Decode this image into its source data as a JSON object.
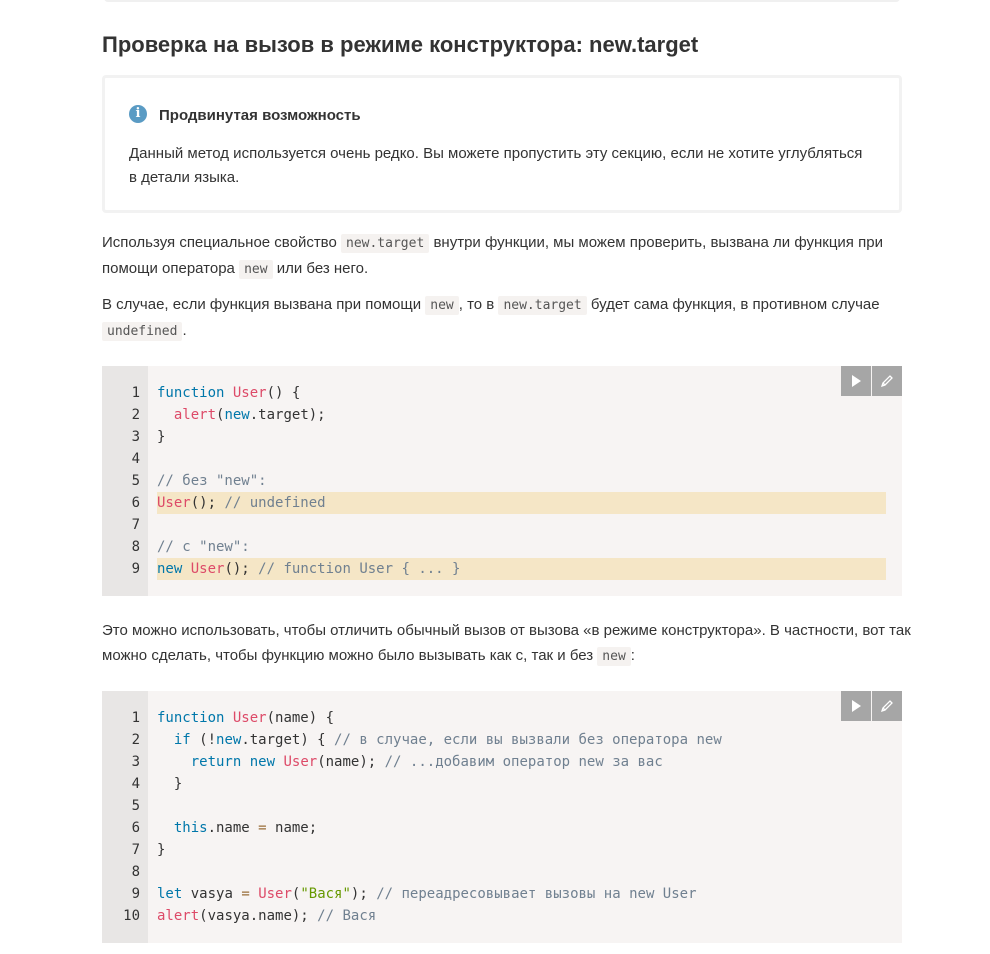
{
  "heading": "Проверка на вызов в режиме конструктора: new.target",
  "note": {
    "icon": "info-icon",
    "title": "Продвинутая возможность",
    "text": "Данный метод используется очень редко. Вы можете пропустить эту секцию, если не хотите углубляться в детали языка."
  },
  "para1": {
    "t1": "Используя специальное свойство ",
    "c1": "new.target",
    "t2": " внутри функции, мы можем проверить, вызвана ли функция при помощи оператора ",
    "c2": "new",
    "t3": " или без него."
  },
  "para2": {
    "t1": "В случае, если функция вызвана при помощи ",
    "c1": "new",
    "t2": ", то в ",
    "c2": "new.target",
    "t3": " будет сама функция, в противном случае ",
    "c3": "undefined",
    "t4": "."
  },
  "para3": {
    "t1": "Это можно использовать, чтобы отличить обычный вызов от вызова «в режиме конструктора». В частности, вот так можно сделать, чтобы функцию можно было вызывать как с, так и без ",
    "c1": "new",
    "t2": ":"
  },
  "code1": {
    "lines": [
      {
        "n": "1",
        "parts": [
          [
            "kw",
            "function"
          ],
          [
            "",
            "  "
          ],
          [
            "fn",
            "User"
          ],
          [
            "",
            "() {"
          ]
        ]
      },
      {
        "n": "2",
        "parts": [
          [
            "",
            "  "
          ],
          [
            "fn",
            "alert"
          ],
          [
            "",
            "("
          ],
          [
            "kw",
            "new"
          ],
          [
            "",
            ".target);"
          ]
        ]
      },
      {
        "n": "3",
        "parts": [
          [
            "",
            "}"
          ]
        ]
      },
      {
        "n": "4",
        "parts": []
      },
      {
        "n": "5",
        "parts": [
          [
            "cm",
            "// без \"new\":"
          ]
        ]
      },
      {
        "n": "6",
        "hl": true,
        "parts": [
          [
            "fn",
            "User"
          ],
          [
            "",
            "(); "
          ],
          [
            "cm",
            "// undefined"
          ]
        ]
      },
      {
        "n": "7",
        "parts": []
      },
      {
        "n": "8",
        "parts": [
          [
            "cm",
            "// с \"new\":"
          ]
        ]
      },
      {
        "n": "9",
        "hl": true,
        "parts": [
          [
            "kw",
            "new"
          ],
          [
            "",
            " "
          ],
          [
            "fn",
            "User"
          ],
          [
            "",
            "(); "
          ],
          [
            "cm",
            "// function User { ... }"
          ]
        ]
      }
    ]
  },
  "code2": {
    "lines": [
      {
        "n": "1",
        "parts": [
          [
            "kw",
            "function"
          ],
          [
            "",
            " "
          ],
          [
            "fn",
            "User"
          ],
          [
            "",
            "(name) {"
          ]
        ]
      },
      {
        "n": "2",
        "parts": [
          [
            "",
            "  "
          ],
          [
            "kw",
            "if"
          ],
          [
            "",
            " (!"
          ],
          [
            "kw",
            "new"
          ],
          [
            "",
            ".target) { "
          ],
          [
            "cm",
            "// в случае, если вы вызвали без оператора new"
          ]
        ]
      },
      {
        "n": "3",
        "parts": [
          [
            "",
            "    "
          ],
          [
            "kw",
            "return"
          ],
          [
            "",
            " "
          ],
          [
            "kw",
            "new"
          ],
          [
            "",
            " "
          ],
          [
            "fn",
            "User"
          ],
          [
            "",
            "(name); "
          ],
          [
            "cm",
            "// ...добавим оператор new за вас"
          ]
        ]
      },
      {
        "n": "4",
        "parts": [
          [
            "",
            "  }"
          ]
        ]
      },
      {
        "n": "5",
        "parts": []
      },
      {
        "n": "6",
        "parts": [
          [
            "",
            "  "
          ],
          [
            "kw",
            "this"
          ],
          [
            "",
            ".name "
          ],
          [
            "op",
            "="
          ],
          [
            "",
            " name;"
          ]
        ]
      },
      {
        "n": "7",
        "parts": [
          [
            "",
            "}"
          ]
        ]
      },
      {
        "n": "8",
        "parts": []
      },
      {
        "n": "9",
        "parts": [
          [
            "kw",
            "let"
          ],
          [
            "",
            " vasya "
          ],
          [
            "op",
            "="
          ],
          [
            "",
            " "
          ],
          [
            "fn",
            "User"
          ],
          [
            "",
            "("
          ],
          [
            "st",
            "\"Вася\""
          ],
          [
            "",
            "); "
          ],
          [
            "cm",
            "// переадресовывает вызовы на new User"
          ]
        ]
      },
      {
        "n": "10",
        "parts": [
          [
            "fn",
            "alert"
          ],
          [
            "",
            "(vasya.name); "
          ],
          [
            "cm",
            "// Вася"
          ]
        ]
      }
    ]
  },
  "tools": {
    "run_icon": "play-icon",
    "edit_icon": "pencil-icon"
  }
}
